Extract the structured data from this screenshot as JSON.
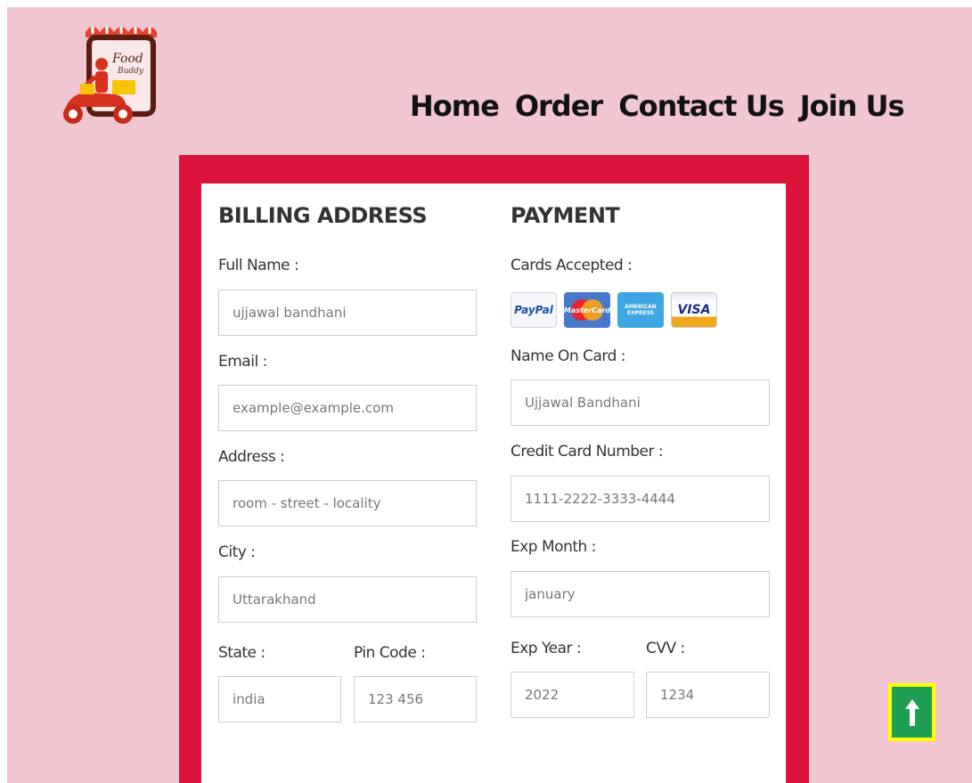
{
  "logo": {
    "line1": "Food",
    "line2": "Buddy"
  },
  "nav": {
    "items": [
      "Home",
      "Order",
      "Contact Us",
      "Join Us"
    ]
  },
  "billing": {
    "heading": "BILLING ADDRESS",
    "full_name": {
      "label": "Full Name :",
      "placeholder": "ujjawal bandhani"
    },
    "email": {
      "label": "Email :",
      "placeholder": "example@example.com"
    },
    "address": {
      "label": "Address :",
      "placeholder": "room - street - locality"
    },
    "city": {
      "label": "City :",
      "placeholder": "Uttarakhand"
    },
    "state": {
      "label": "State :",
      "placeholder": "india"
    },
    "pin_code": {
      "label": "Pin Code :",
      "placeholder": "123 456"
    }
  },
  "payment": {
    "heading": "PAYMENT",
    "cards_label": "Cards Accepted :",
    "card_logos": {
      "paypal": "PayPal",
      "mastercard": "MasterCard",
      "amex_line1": "AMERICAN",
      "amex_line2": "EXPRESS",
      "visa": "VISA"
    },
    "name_on_card": {
      "label": "Name On Card :",
      "placeholder": "Ujjawal Bandhani"
    },
    "card_number": {
      "label": "Credit Card Number :",
      "placeholder": "1111-2222-3333-4444"
    },
    "exp_month": {
      "label": "Exp Month :",
      "placeholder": "january"
    },
    "exp_year": {
      "label": "Exp Year :",
      "placeholder": "2022"
    },
    "cvv": {
      "label": "CVV :",
      "placeholder": "1234"
    }
  },
  "colors": {
    "page_bg": "#f0c6d0",
    "frame": "#dc143c",
    "totop_bg": "#1e9e52",
    "totop_border": "#ffff00"
  },
  "icons": {
    "scroll_top": "arrow-up-icon"
  }
}
